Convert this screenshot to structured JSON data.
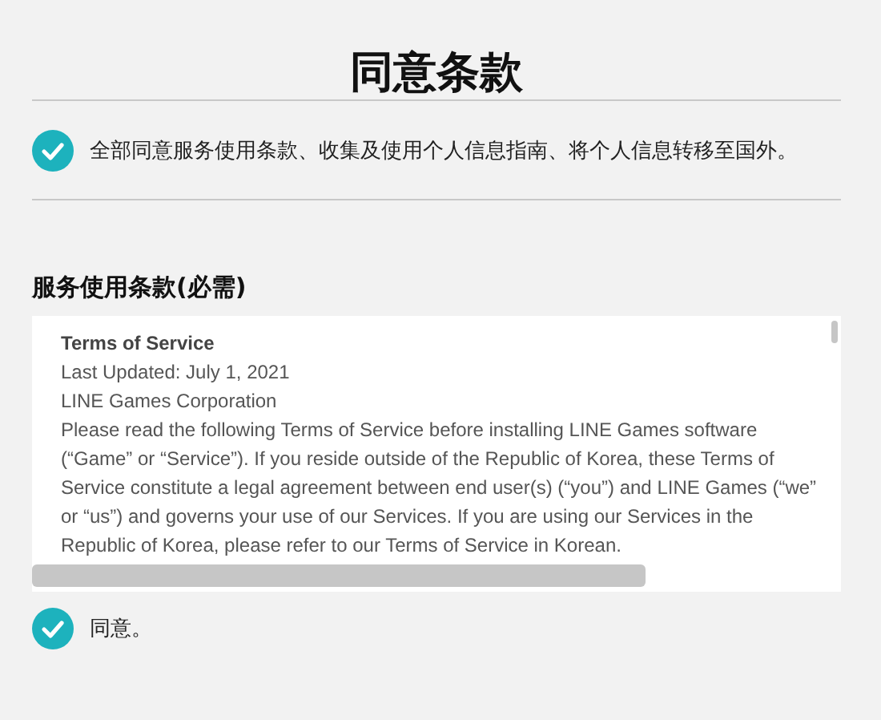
{
  "title": "同意条款",
  "agree_all": {
    "label": "全部同意服务使用条款、收集及使用个人信息指南、将个人信息转移至国外。",
    "checked": true
  },
  "section": {
    "heading": "服务使用条款(必需)",
    "terms": {
      "title": "Terms of Service",
      "lines": [
        "Last Updated: July 1, 2021",
        "LINE Games Corporation"
      ],
      "body": "Please read the following Terms of Service before installing LINE Games software (“Game” or “Service”).  If you reside outside of the Republic of Korea, these Terms of Service constitute a legal agreement between end user(s) (“you”) and LINE Games (“we” or “us”) and governs your use of our Services.  If you are using our Services in the Republic of Korea, please refer to our Terms of Service in Korean."
    },
    "agree": {
      "label": "同意。",
      "checked": true
    }
  }
}
